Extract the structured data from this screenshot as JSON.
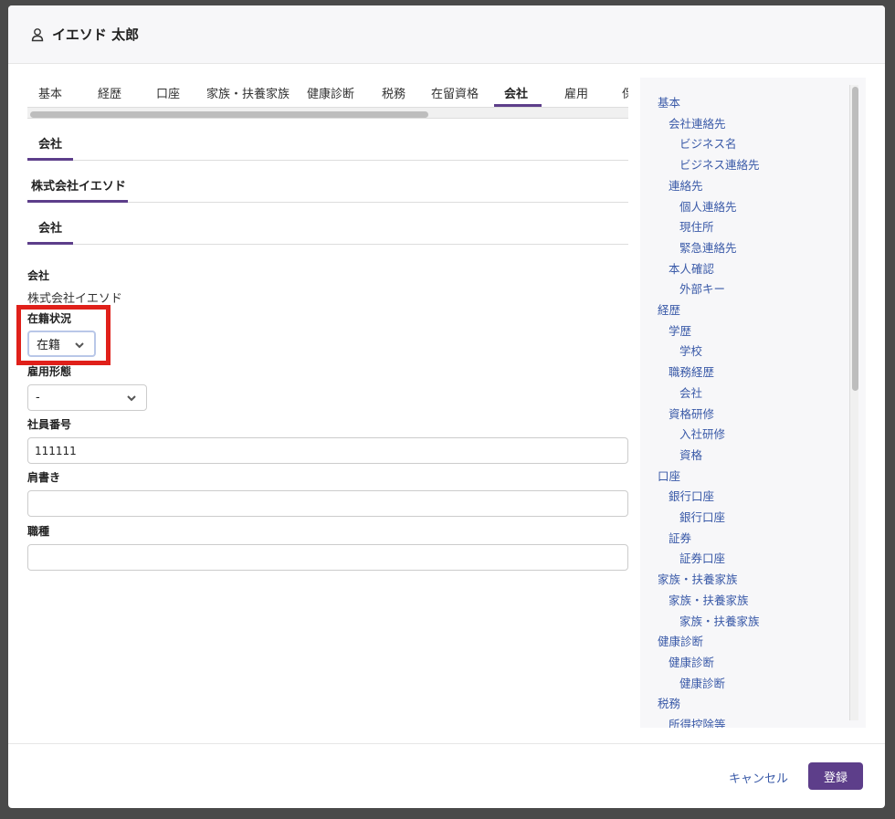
{
  "header": {
    "title": "イエソド 太郎",
    "icon": "user-icon"
  },
  "tabs": [
    {
      "label": "基本"
    },
    {
      "label": "経歴"
    },
    {
      "label": "口座"
    },
    {
      "label": "家族・扶養家族"
    },
    {
      "label": "健康診断"
    },
    {
      "label": "税務"
    },
    {
      "label": "在留資格"
    },
    {
      "label": "会社",
      "active": true
    },
    {
      "label": "雇用"
    },
    {
      "label": "保"
    }
  ],
  "sections": {
    "company": "会社",
    "company_name": "株式会社イエソド",
    "company_sub": "会社"
  },
  "fields": {
    "company_label": "会社",
    "company_value": "株式会社イエソド",
    "status_label": "在籍状況",
    "status_value": "在籍",
    "employment_type_label": "雇用形態",
    "employment_type_value": "-",
    "employee_number_label": "社員番号",
    "employee_number_value": "111111",
    "title_label": "肩書き",
    "title_value": "",
    "job_type_label": "職種",
    "job_type_value": ""
  },
  "toc": [
    {
      "label": "基本",
      "level": 0
    },
    {
      "label": "会社連絡先",
      "level": 1
    },
    {
      "label": "ビジネス名",
      "level": 2
    },
    {
      "label": "ビジネス連絡先",
      "level": 2
    },
    {
      "label": "連絡先",
      "level": 1
    },
    {
      "label": "個人連絡先",
      "level": 2
    },
    {
      "label": "現住所",
      "level": 2
    },
    {
      "label": "緊急連絡先",
      "level": 2
    },
    {
      "label": "本人確認",
      "level": 1
    },
    {
      "label": "外部キー",
      "level": 2
    },
    {
      "label": "経歴",
      "level": 0
    },
    {
      "label": "学歴",
      "level": 1
    },
    {
      "label": "学校",
      "level": 2
    },
    {
      "label": "職務経歴",
      "level": 1
    },
    {
      "label": "会社",
      "level": 2
    },
    {
      "label": "資格研修",
      "level": 1
    },
    {
      "label": "入社研修",
      "level": 2
    },
    {
      "label": "資格",
      "level": 2
    },
    {
      "label": "口座",
      "level": 0
    },
    {
      "label": "銀行口座",
      "level": 1
    },
    {
      "label": "銀行口座",
      "level": 2
    },
    {
      "label": "証券",
      "level": 1
    },
    {
      "label": "証券口座",
      "level": 2
    },
    {
      "label": "家族・扶養家族",
      "level": 0
    },
    {
      "label": "家族・扶養家族",
      "level": 1
    },
    {
      "label": "家族・扶養家族",
      "level": 2
    },
    {
      "label": "健康診断",
      "level": 0
    },
    {
      "label": "健康診断",
      "level": 1
    },
    {
      "label": "健康診断",
      "level": 2
    },
    {
      "label": "税務",
      "level": 0
    },
    {
      "label": "所得控除等",
      "level": 1
    }
  ],
  "footer": {
    "cancel_label": "キャンセル",
    "submit_label": "登録"
  },
  "colors": {
    "accent": "#5d3e8a",
    "link": "#3a5aa8",
    "highlight": "#e0201a"
  }
}
